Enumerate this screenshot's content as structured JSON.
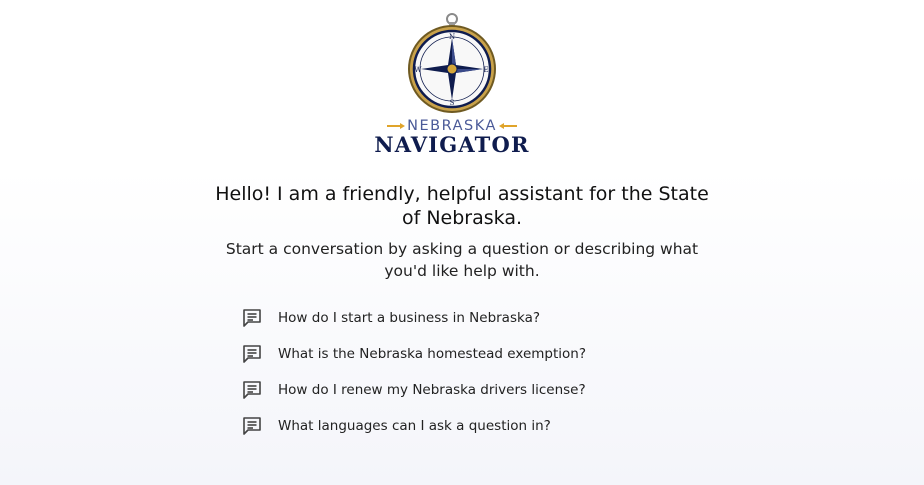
{
  "logo": {
    "compass_letters": {
      "n": "N",
      "s": "S",
      "e": "E",
      "w": "W"
    },
    "state": "NEBRASKA",
    "word": "NAVIGATOR",
    "colors": {
      "navy": "#0f1c4e",
      "blue": "#4b5a98",
      "gold": "#e0a42a"
    }
  },
  "greeting": "Hello! I am a friendly, helpful assistant for the State of Nebraska.",
  "subtitle": "Start a conversation by asking a question or describing what you'd like help with.",
  "suggestions": [
    {
      "icon": "chat-icon",
      "text": "How do I start a business in Nebraska?"
    },
    {
      "icon": "chat-icon",
      "text": "What is the Nebraska homestead exemption?"
    },
    {
      "icon": "chat-icon",
      "text": "How do I renew my Nebraska drivers license?"
    },
    {
      "icon": "chat-icon",
      "text": "What languages can I ask a question in?"
    }
  ]
}
